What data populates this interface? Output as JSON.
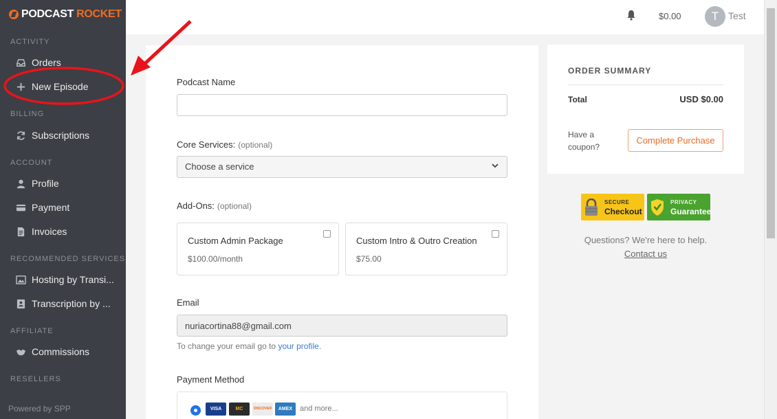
{
  "brand": {
    "part1": "PODCAST",
    "part2": "ROCKET"
  },
  "sidebar": {
    "sections": {
      "activity": "ACTIVITY",
      "billing": "BILLING",
      "account": "ACCOUNT",
      "recommended": "RECOMMENDED SERVICES",
      "affiliate": "AFFILIATE",
      "resellers": "RESELLERS"
    },
    "items": {
      "orders": "Orders",
      "new_episode": "New Episode",
      "subscriptions": "Subscriptions",
      "profile": "Profile",
      "payment": "Payment",
      "invoices": "Invoices",
      "hosting": "Hosting by Transi...",
      "transcription": "Transcription by ...",
      "commissions": "Commissions"
    },
    "powered": "Powered by SPP"
  },
  "topbar": {
    "balance": "$0.00",
    "avatar_initial": "T",
    "username": "Test"
  },
  "form": {
    "podcast_name_label": "Podcast Name",
    "podcast_name_value": "",
    "core_label": "Core Services:",
    "optional": "(optional)",
    "core_placeholder": "Choose a service",
    "addons_label": "Add-Ons:",
    "addons": [
      {
        "name": "Custom Admin Package",
        "price": "$100.00/month"
      },
      {
        "name": "Custom Intro & Outro Creation",
        "price": "$75.00"
      }
    ],
    "email_label": "Email",
    "email_value": "nuriacortina88@gmail.com",
    "email_hint": "To change your email go to",
    "email_hint_link": "your profile",
    "email_hint_end": ".",
    "payment_label": "Payment Method",
    "cards": [
      "VISA",
      "MC",
      "DISCOVER",
      "AMEX"
    ],
    "and_more": "and more..."
  },
  "summary": {
    "title": "ORDER SUMMARY",
    "total_label": "Total",
    "total_value": "USD $0.00",
    "coupon": "Have a coupon?",
    "purchase": "Complete Purchase"
  },
  "badges": {
    "secure_small": "SECURE",
    "secure_big": "Checkout",
    "privacy_small": "PRIVACY",
    "privacy_big": "Guarantee"
  },
  "help": {
    "text": "Questions? We're here to help.",
    "contact": "Contact us"
  },
  "colors": {
    "sidebar": "#3c3f45",
    "accent": "#f26b21",
    "link": "#3a7bd5",
    "annotation": "#e8141b"
  }
}
